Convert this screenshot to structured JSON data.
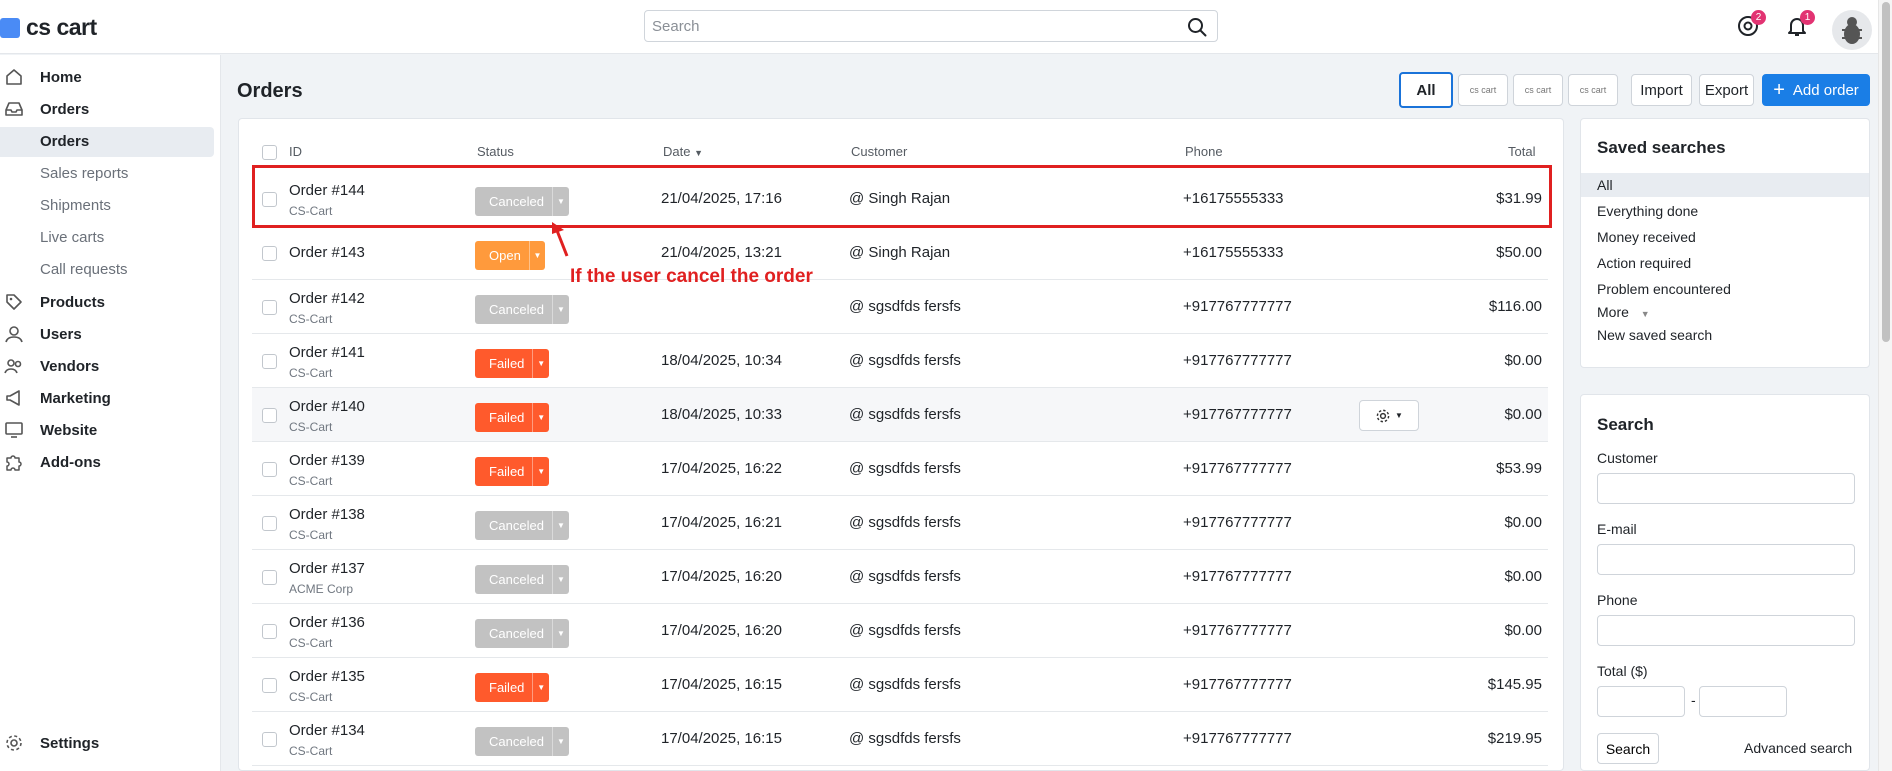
{
  "header": {
    "logo_text": "cs cart",
    "search_placeholder": "Search",
    "badges": {
      "help": "2",
      "notifications": "1"
    }
  },
  "sidebar": {
    "items": [
      {
        "label": "Home",
        "icon": "home-icon"
      },
      {
        "label": "Orders",
        "icon": "inbox-icon"
      },
      {
        "label": "Products",
        "icon": "tag-icon"
      },
      {
        "label": "Users",
        "icon": "user-icon"
      },
      {
        "label": "Vendors",
        "icon": "vendors-icon"
      },
      {
        "label": "Marketing",
        "icon": "megaphone-icon"
      },
      {
        "label": "Website",
        "icon": "monitor-icon"
      },
      {
        "label": "Add-ons",
        "icon": "puzzle-icon"
      }
    ],
    "order_subitems": [
      "Orders",
      "Sales reports",
      "Shipments",
      "Live carts",
      "Call requests"
    ],
    "settings": "Settings"
  },
  "page": {
    "title": "Orders",
    "toolbar": {
      "all": "All",
      "mini_logo": "cs cart",
      "import": "Import",
      "export": "Export",
      "add_order": "Add order"
    }
  },
  "table": {
    "columns": {
      "id": "ID",
      "status": "Status",
      "date": "Date",
      "customer": "Customer",
      "phone": "Phone",
      "total": "Total"
    },
    "rows": [
      {
        "id": "Order #144",
        "company": "CS-Cart",
        "status": "Canceled",
        "date": "21/04/2025, 17:16",
        "customer": "@ Singh Rajan",
        "phone": "+16175555333",
        "total": "$31.99"
      },
      {
        "id": "Order #143",
        "company": "",
        "status": "Open",
        "date": "21/04/2025, 13:21",
        "customer": "@ Singh Rajan",
        "phone": "+16175555333",
        "total": "$50.00"
      },
      {
        "id": "Order #142",
        "company": "CS-Cart",
        "status": "Canceled",
        "date": "",
        "customer": "@ sgsdfds fersfs",
        "phone": "+917767777777",
        "total": "$116.00"
      },
      {
        "id": "Order #141",
        "company": "CS-Cart",
        "status": "Failed",
        "date": "18/04/2025, 10:34",
        "customer": "@ sgsdfds fersfs",
        "phone": "+917767777777",
        "total": "$0.00"
      },
      {
        "id": "Order #140",
        "company": "CS-Cart",
        "status": "Failed",
        "date": "18/04/2025, 10:33",
        "customer": "@ sgsdfds fersfs",
        "phone": "+917767777777",
        "total": "$0.00"
      },
      {
        "id": "Order #139",
        "company": "CS-Cart",
        "status": "Failed",
        "date": "17/04/2025, 16:22",
        "customer": "@ sgsdfds fersfs",
        "phone": "+917767777777",
        "total": "$53.99"
      },
      {
        "id": "Order #138",
        "company": "CS-Cart",
        "status": "Canceled",
        "date": "17/04/2025, 16:21",
        "customer": "@ sgsdfds fersfs",
        "phone": "+917767777777",
        "total": "$0.00"
      },
      {
        "id": "Order #137",
        "company": "ACME Corp",
        "status": "Canceled",
        "date": "17/04/2025, 16:20",
        "customer": "@ sgsdfds fersfs",
        "phone": "+917767777777",
        "total": "$0.00"
      },
      {
        "id": "Order #136",
        "company": "CS-Cart",
        "status": "Canceled",
        "date": "17/04/2025, 16:20",
        "customer": "@ sgsdfds fersfs",
        "phone": "+917767777777",
        "total": "$0.00"
      },
      {
        "id": "Order #135",
        "company": "CS-Cart",
        "status": "Failed",
        "date": "17/04/2025, 16:15",
        "customer": "@ sgsdfds fersfs",
        "phone": "+917767777777",
        "total": "$145.95"
      },
      {
        "id": "Order #134",
        "company": "CS-Cart",
        "status": "Canceled",
        "date": "17/04/2025, 16:15",
        "customer": "@ sgsdfds fersfs",
        "phone": "+917767777777",
        "total": "$219.95"
      }
    ]
  },
  "annotation": {
    "text": "If the user cancel the order",
    "color": "#e02020"
  },
  "saved_searches": {
    "title": "Saved searches",
    "items": [
      "All",
      "Everything done",
      "Money received",
      "Action required",
      "Problem encountered"
    ],
    "more": "More",
    "new": "New saved search"
  },
  "search_panel": {
    "title": "Search",
    "customer": "Customer",
    "email": "E-mail",
    "phone": "Phone",
    "total": "Total ($)",
    "dash": "-",
    "search_button": "Search",
    "advanced": "Advanced search"
  },
  "colors": {
    "accent": "#1a7ee6",
    "canceled": "#c2c2c2",
    "open": "#ff9a3c",
    "failed": "#ff5a2c"
  }
}
